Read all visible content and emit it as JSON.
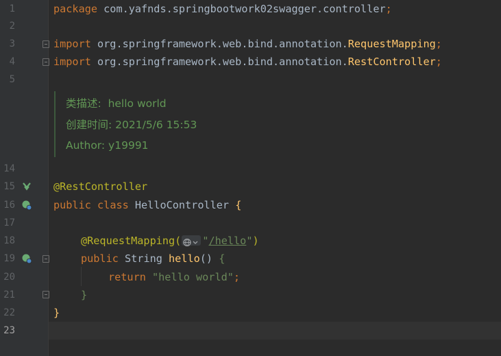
{
  "gutter": {
    "line_numbers": [
      "1",
      "2",
      "3",
      "4",
      "5",
      "14",
      "15",
      "16",
      "17",
      "18",
      "19",
      "20",
      "21",
      "22",
      "23"
    ]
  },
  "code": {
    "l1": {
      "kw": "package",
      "rest": " com.yafnds.springbootwork02swagger.controller",
      "semi": ";"
    },
    "l3": {
      "kw": "import",
      "pkg": " org.springframework.web.bind.annotation.",
      "cls": "RequestMapping",
      "semi": ";"
    },
    "l4": {
      "kw": "import",
      "pkg": " org.springframework.web.bind.annotation.",
      "cls": "RestController",
      "semi": ";"
    },
    "l15": {
      "ann": "@RestController"
    },
    "l16": {
      "kw1": "public",
      "kw2": "class",
      "name": " HelloController ",
      "brace": "{"
    },
    "l18": {
      "ann": "@RequestMapping(",
      "str_open": "\"",
      "path": "/hello",
      "str_close": "\"",
      "paren": ")"
    },
    "l19": {
      "kw": "public",
      "type": " String ",
      "fn": "hello",
      "rest": "() ",
      "brace": "{"
    },
    "l20": {
      "kw": "return",
      "str": " \"hello world\"",
      "semi": ";"
    },
    "l21": {
      "brace": "}"
    },
    "l22": {
      "brace": "}"
    }
  },
  "doc_comment": {
    "description": "类描述:  hello world",
    "created": "创建时间: 2021/5/6 15:53",
    "author": "Author: y19991"
  },
  "colors": {
    "background": "#2b2b2b",
    "keyword": "#cc7832",
    "annotation": "#bbb529",
    "string": "#6a8759",
    "function": "#ffc66d",
    "doc": "#629755"
  }
}
